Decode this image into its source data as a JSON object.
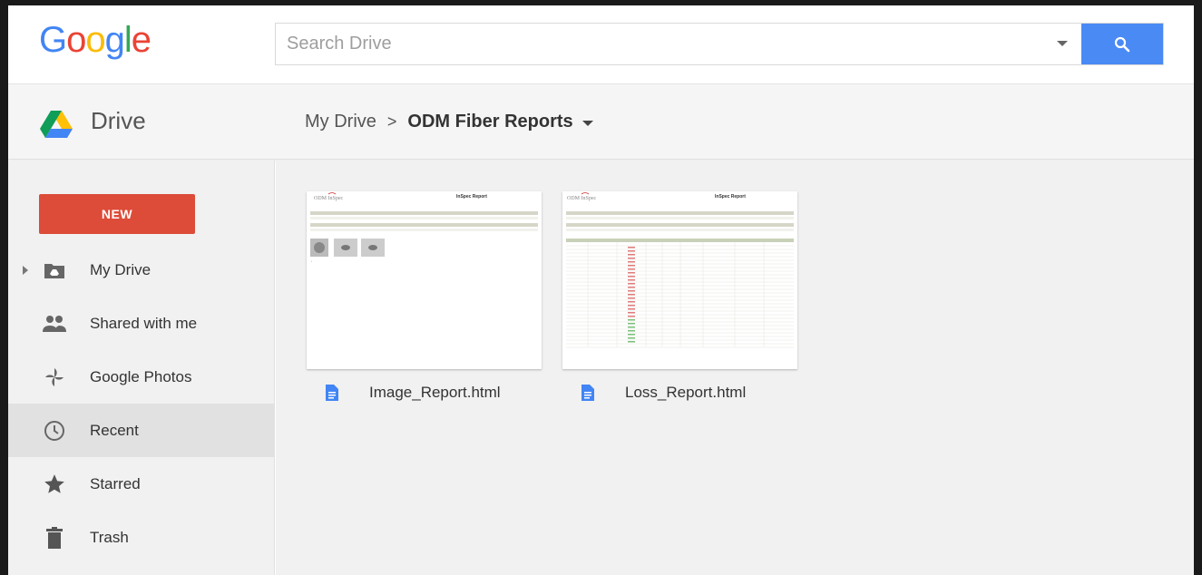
{
  "header": {
    "logo_letters": [
      {
        "ch": "G",
        "color": "#4285f4"
      },
      {
        "ch": "o",
        "color": "#ea4335"
      },
      {
        "ch": "o",
        "color": "#fbbc05"
      },
      {
        "ch": "g",
        "color": "#4285f4"
      },
      {
        "ch": "l",
        "color": "#34a853"
      },
      {
        "ch": "e",
        "color": "#ea4335"
      }
    ],
    "search_placeholder": "Search Drive",
    "search_button_icon": "search-icon",
    "accent": "#4a8af4"
  },
  "drivebar": {
    "title": "Drive",
    "breadcrumb": {
      "root": "My Drive",
      "separator": ">",
      "current": "ODM Fiber Reports"
    }
  },
  "sidebar": {
    "new_label": "NEW",
    "new_color": "#dd4b39",
    "items": [
      {
        "label": "My Drive",
        "icon": "folder-drive-icon"
      },
      {
        "label": "Shared with me",
        "icon": "people-icon"
      },
      {
        "label": "Google Photos",
        "icon": "pinwheel-icon"
      },
      {
        "label": "Recent",
        "icon": "clock-icon",
        "active": true
      },
      {
        "label": "Starred",
        "icon": "star-icon"
      },
      {
        "label": "Trash",
        "icon": "trash-icon"
      }
    ]
  },
  "files": [
    {
      "name": "Image_Report.html",
      "icon": "document-icon",
      "thumb_title": "InSpec Report",
      "thumb_brand": "ODM InSpec"
    },
    {
      "name": "Loss_Report.html",
      "icon": "document-icon",
      "thumb_title": "InSpec Report",
      "thumb_brand": "ODM InSpec"
    }
  ]
}
